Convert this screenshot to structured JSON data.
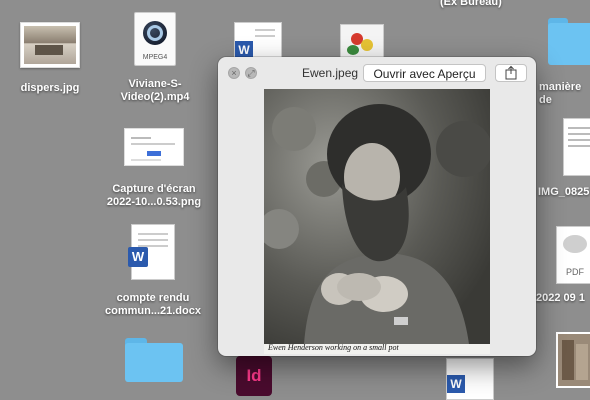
{
  "desktop": {
    "top_right_label": "(Ex Bureau)",
    "files": {
      "dispers": "dispers.jpg",
      "video": "Viviane-S-\nVideo(2).mp4",
      "video_line1": "Viviane-S-",
      "video_line2": "Video(2).mp4",
      "video_badge": "MPEG4",
      "capture_line1": "Capture d'écran",
      "capture_line2": "2022-10...0.53.png",
      "compte_line1": "compte rendu",
      "compte_line2": "commun...21.docx",
      "maniere": "manière de",
      "img_0825": "IMG_0825",
      "pdf_date": "2022 09 1",
      "pdf_badge": "PDF",
      "word_letter": "W",
      "indesign_letter": "Id"
    }
  },
  "quicklook": {
    "title": "Ewen.jpeg",
    "open_button": "Ouvrir avec Aperçu",
    "caption": "Ewen Henderson working on a small pot"
  }
}
